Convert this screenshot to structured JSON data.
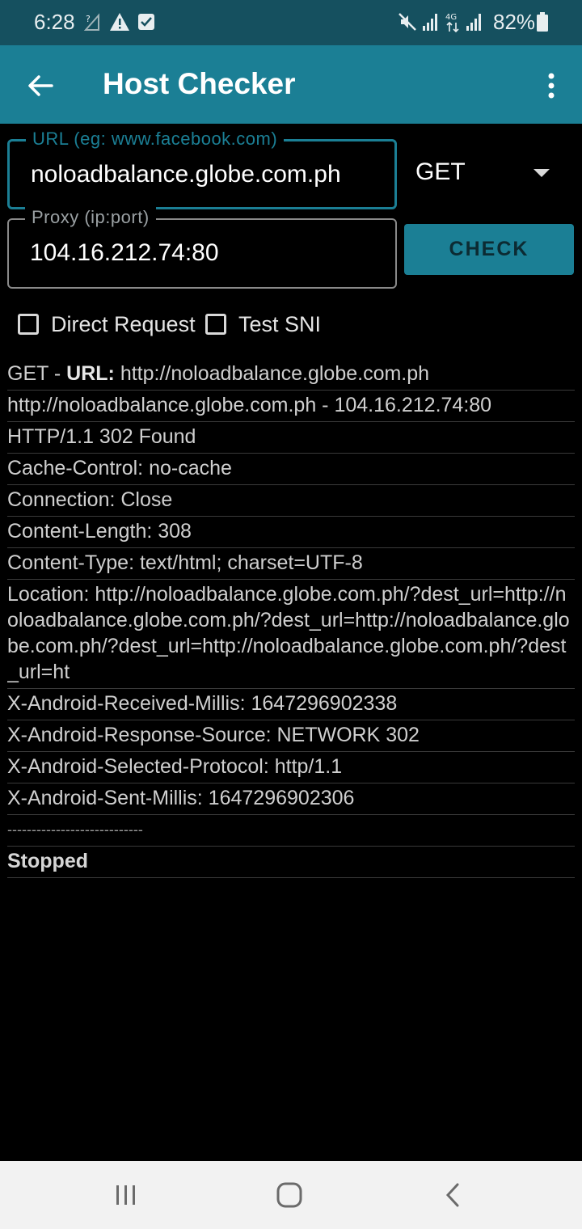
{
  "status_bar": {
    "time": "6:28",
    "battery": "82%",
    "icons": [
      "wifi-question-icon",
      "warning-icon",
      "checkbox-notification-icon",
      "mute-icon",
      "signal-icon",
      "4g-icon",
      "signal-icon",
      "battery-icon"
    ]
  },
  "app_bar": {
    "title": "Host Checker",
    "background": "#1b7f95"
  },
  "form": {
    "url_label": "URL (eg: www.facebook.com)",
    "url_value": "noloadbalance.globe.com.ph",
    "proxy_label": "Proxy (ip:port)",
    "proxy_value": "104.16.212.74:80",
    "method": "GET",
    "check_label": "CHECK",
    "direct_request_label": "Direct Request",
    "test_sni_label": "Test SNI"
  },
  "log": {
    "request_method": "GET - ",
    "request_url_key": "URL:",
    "request_url_value": " http://noloadbalance.globe.com.ph",
    "lines": [
      "http://noloadbalance.globe.com.ph - 104.16.212.74:80",
      "HTTP/1.1 302 Found",
      "Cache-Control: no-cache",
      "Connection: Close",
      "Content-Length: 308",
      "Content-Type: text/html; charset=UTF-8",
      "Location: http://noloadbalance.globe.com.ph/?dest_url=http://noloadbalance.globe.com.ph/?dest_url=http://noloadbalance.globe.com.ph/?dest_url=http://noloadbalance.globe.com.ph/?dest_url=ht",
      "X-Android-Received-Millis: 1647296902338",
      "X-Android-Response-Source: NETWORK 302",
      "X-Android-Selected-Protocol: http/1.1",
      "X-Android-Sent-Millis: 1647296902306",
      "----------------------------"
    ],
    "status": "Stopped"
  }
}
